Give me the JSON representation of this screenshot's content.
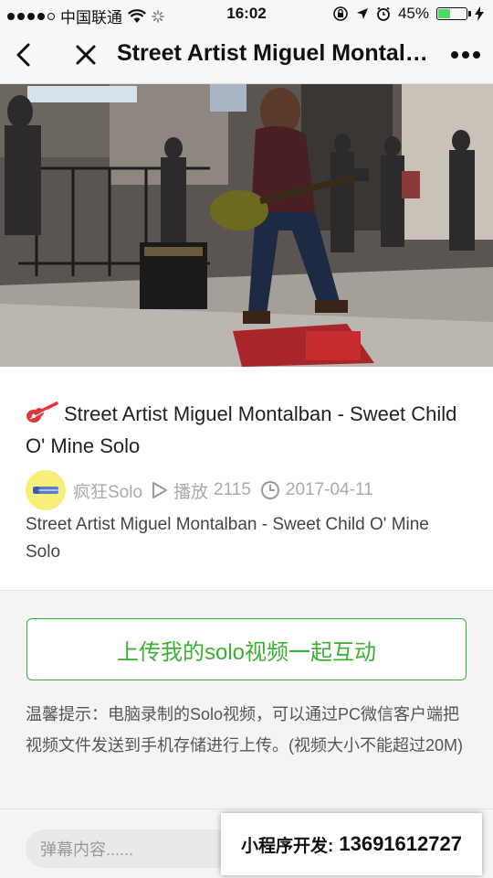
{
  "status_bar": {
    "carrier": "中国联通",
    "time": "16:02",
    "battery_percent": "45%",
    "battery_level": 0.45
  },
  "navbar": {
    "title": "Street Artist Miguel Montalban - Sweet Child O' Mine Solo"
  },
  "video": {},
  "info": {
    "title": "Street Artist Miguel Montalban - Sweet Child O' Mine Solo",
    "author": "疯狂Solo",
    "plays_label": "播放",
    "plays": "2115",
    "date": "2017-04-11",
    "description": " Street Artist Miguel Montalban - Sweet Child O' Mine Solo"
  },
  "upload": {
    "button_label": "上传我的solo视频一起互动",
    "tip": " 温馨提示：电脑录制的Solo视频，可以通过PC微信客户端把视频文件发送到手机存储进行上传。(视频大小不能超过20M)"
  },
  "bottom": {
    "danmu_placeholder": "弹幕内容......"
  },
  "ad": {
    "label": "小程序开发:",
    "phone": "13691612727"
  },
  "colors": {
    "accent_green": "#3cb034",
    "battery_green": "#4cd964",
    "guitar_red": "#e0383a"
  }
}
